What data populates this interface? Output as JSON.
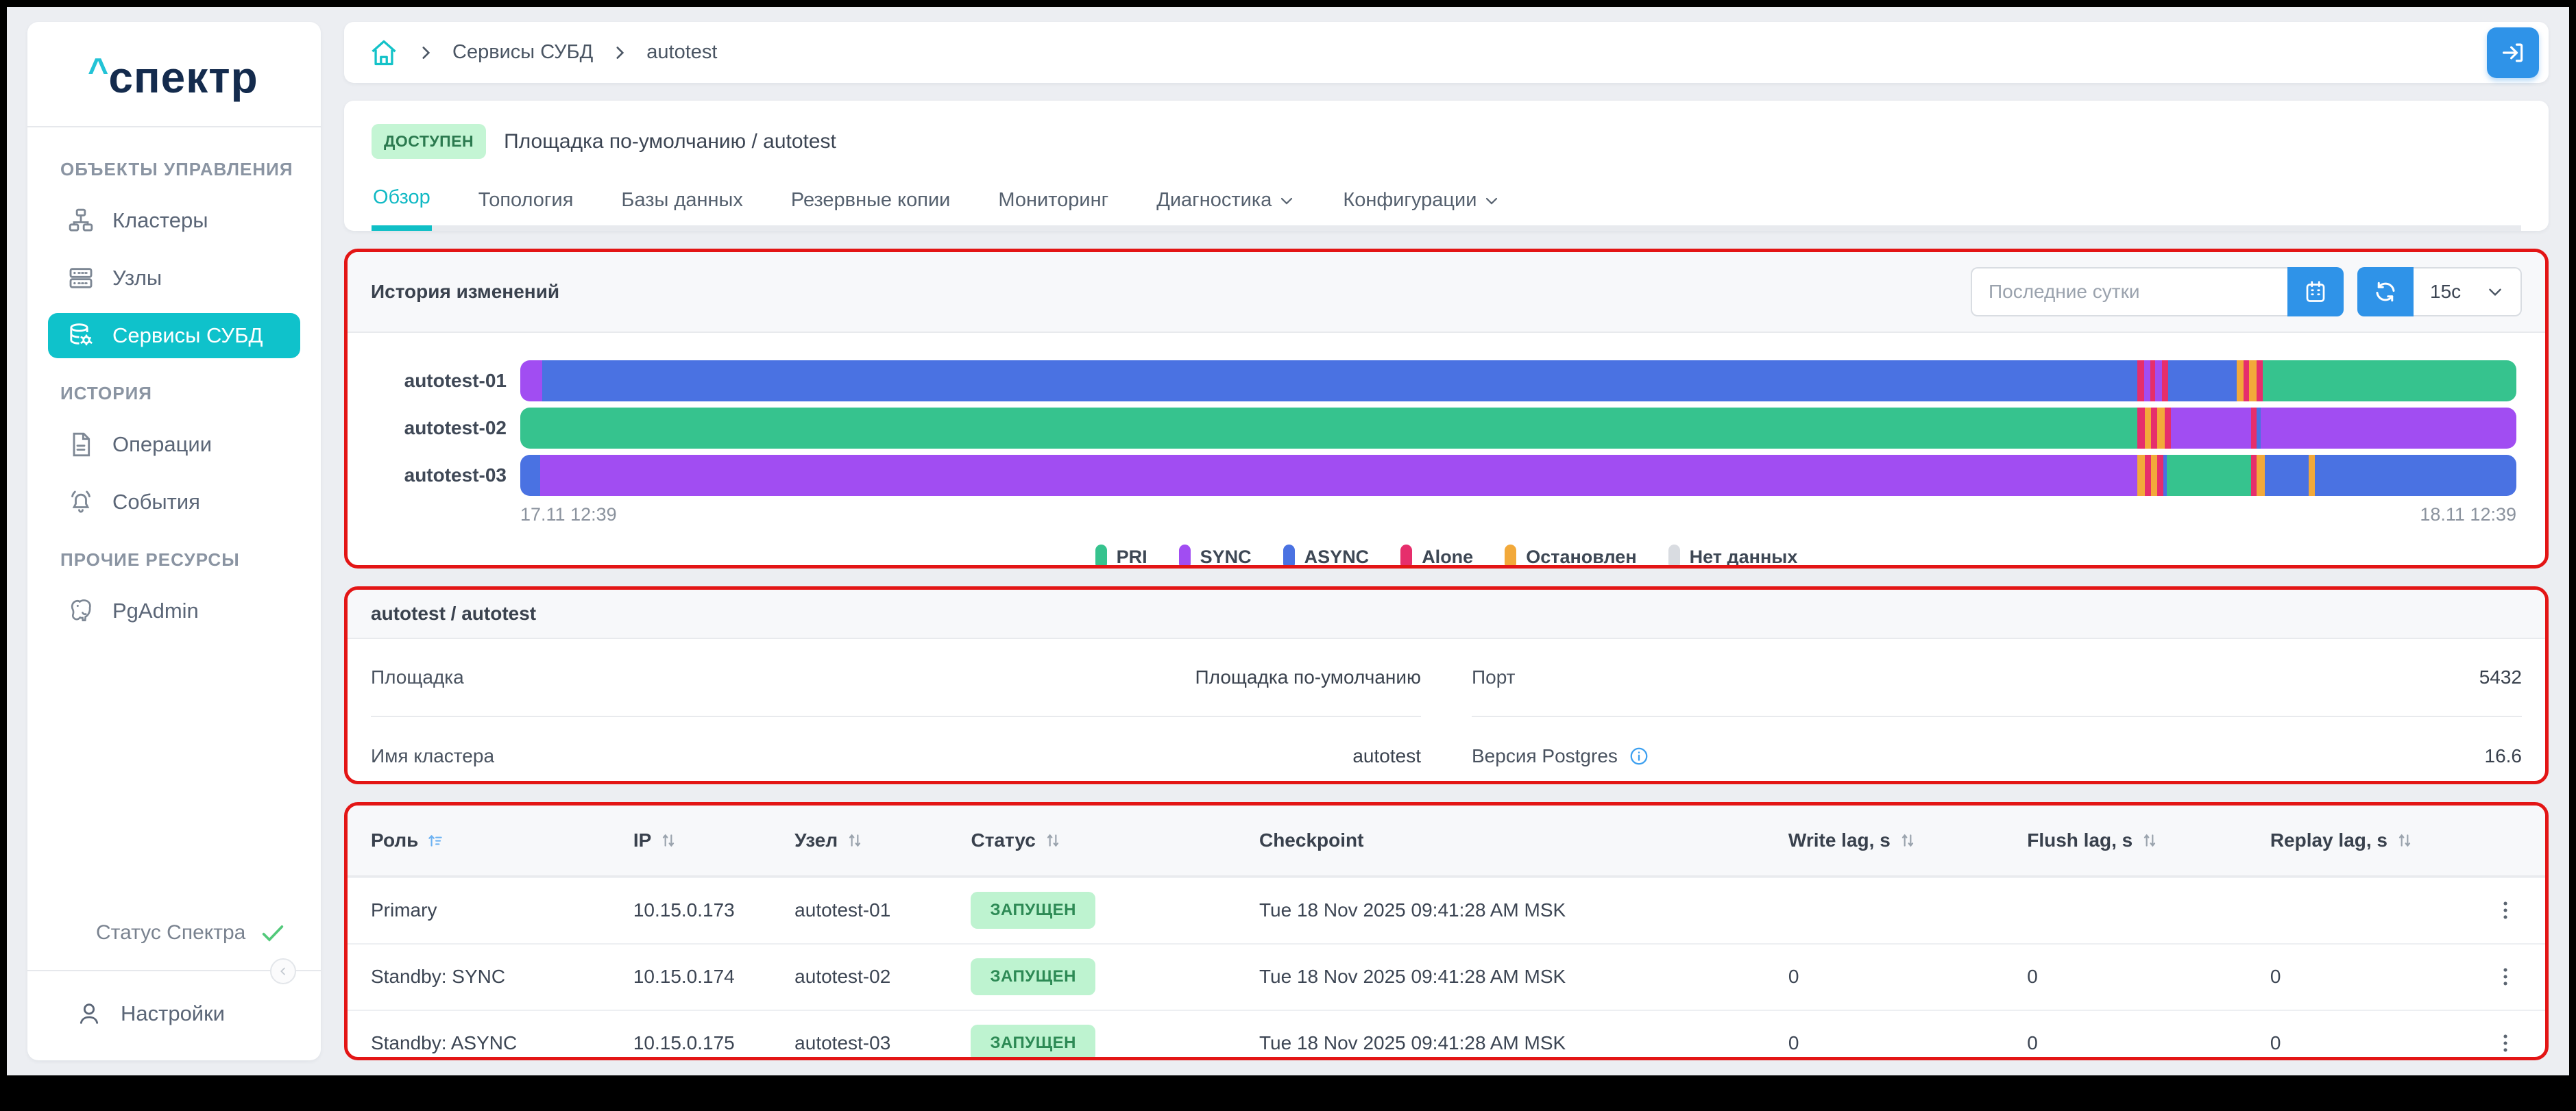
{
  "sidebar": {
    "logo_caret": "^",
    "logo_text": "спектр",
    "section_objects": "ОБЪЕКТЫ УПРАВЛЕНИЯ",
    "item_clusters": "Кластеры",
    "item_nodes": "Узлы",
    "item_services": "Сервисы СУБД",
    "section_history": "ИСТОРИЯ",
    "item_operations": "Операции",
    "item_events": "События",
    "section_other": "ПРОЧИЕ РЕСУРСЫ",
    "item_pgadmin": "PgAdmin",
    "status_label": "Статус Спектра",
    "item_settings": "Настройки"
  },
  "breadcrumb": {
    "item1": "Сервисы СУБД",
    "item2": "autotest"
  },
  "header": {
    "status_badge": "ДОСТУПЕН",
    "title": "Площадка по-умолчанию /  autotest"
  },
  "tabs": {
    "items": [
      {
        "label": "Обзор",
        "active": true
      },
      {
        "label": "Топология",
        "active": false
      },
      {
        "label": "Базы данных",
        "active": false
      },
      {
        "label": "Резервные копии",
        "active": false
      },
      {
        "label": "Мониторинг",
        "active": false
      },
      {
        "label": "Диагностика",
        "active": false,
        "dropdown": true
      },
      {
        "label": "Конфигурации",
        "active": false,
        "dropdown": true
      }
    ]
  },
  "history": {
    "title": "История изменений",
    "range_placeholder": "Последние сутки",
    "refresh_interval": "15с",
    "chart_data": {
      "type": "timeline_status_bar",
      "x_start": "17.11 12:39",
      "x_end": "18.11 12:39",
      "legend": [
        {
          "label": "PRI",
          "color": "#36c38e"
        },
        {
          "label": "SYNC",
          "color": "#a14df2"
        },
        {
          "label": "ASYNC",
          "color": "#4a72e2"
        },
        {
          "label": "Alone",
          "color": "#e62e6c"
        },
        {
          "label": "Остановлен",
          "color": "#f2a93a"
        },
        {
          "label": "Нет данных",
          "color": "#d9dce1"
        }
      ],
      "rows": [
        {
          "label": "autotest-01",
          "segments": [
            [
              "SYNC",
              1.1
            ],
            [
              "ASYNC",
              79.9
            ],
            [
              "Alone",
              0.35
            ],
            [
              "SYNC",
              0.3
            ],
            [
              "Alone",
              0.25
            ],
            [
              "SYNC",
              0.35
            ],
            [
              "Alone",
              0.3
            ],
            [
              "ASYNC",
              3.45
            ],
            [
              "Остановлен",
              0.35
            ],
            [
              "Alone",
              0.25
            ],
            [
              "Остановлен",
              0.4
            ],
            [
              "Alone",
              0.3
            ],
            [
              "PRI",
              12.7
            ]
          ]
        },
        {
          "label": "autotest-02",
          "segments": [
            [
              "PRI",
              81.0
            ],
            [
              "Alone",
              0.4
            ],
            [
              "Остановлен",
              0.3
            ],
            [
              "Alone",
              0.3
            ],
            [
              "Остановлен",
              0.4
            ],
            [
              "Alone",
              0.3
            ],
            [
              "SYNC",
              4.0
            ],
            [
              "Alone",
              0.3
            ],
            [
              "ASYNC",
              0.2
            ],
            [
              "SYNC",
              12.8
            ]
          ]
        },
        {
          "label": "autotest-03",
          "segments": [
            [
              "ASYNC",
              1.0
            ],
            [
              "SYNC",
              80.0
            ],
            [
              "Остановлен",
              0.4
            ],
            [
              "Alone",
              0.3
            ],
            [
              "Остановлен",
              0.3
            ],
            [
              "Alone",
              0.3
            ],
            [
              "ASYNC",
              0.2
            ],
            [
              "PRI",
              4.2
            ],
            [
              "Alone",
              0.3
            ],
            [
              "Остановлен",
              0.4
            ],
            [
              "ASYNC",
              2.2
            ],
            [
              "Остановлен",
              0.3
            ],
            [
              "ASYNC",
              10.1
            ]
          ]
        }
      ]
    }
  },
  "info_card": {
    "title": "autotest / autotest",
    "site_label": "Площадка",
    "site_value": "Площадка по-умолчанию",
    "port_label": "Порт",
    "port_value": "5432",
    "cluster_label": "Имя кластера",
    "cluster_value": "autotest",
    "version_label": "Версия Postgres",
    "version_value": "16.6"
  },
  "table": {
    "headers": {
      "role": "Роль",
      "ip": "IP",
      "node": "Узел",
      "status": "Статус",
      "checkpoint": "Checkpoint",
      "write": "Write lag, s",
      "flush": "Flush lag, s",
      "replay": "Replay lag, s"
    },
    "rows": [
      {
        "role": "Primary",
        "ip": "10.15.0.173",
        "node": "autotest-01",
        "status": "ЗАПУЩЕН",
        "checkpoint": "Tue 18 Nov 2025 09:41:28 AM MSK",
        "write": "",
        "flush": "",
        "replay": ""
      },
      {
        "role": "Standby: SYNC",
        "ip": "10.15.0.174",
        "node": "autotest-02",
        "status": "ЗАПУЩЕН",
        "checkpoint": "Tue 18 Nov 2025 09:41:28 AM MSK",
        "write": "0",
        "flush": "0",
        "replay": "0"
      },
      {
        "role": "Standby: ASYNC",
        "ip": "10.15.0.175",
        "node": "autotest-03",
        "status": "ЗАПУЩЕН",
        "checkpoint": "Tue 18 Nov 2025 09:41:28 AM MSK",
        "write": "0",
        "flush": "0",
        "replay": "0"
      }
    ]
  },
  "colors": {
    "accent_teal": "#0fc2cb",
    "primary_blue": "#2f93e8",
    "annotation_red": "#e31515",
    "badge_green_bg": "#c4f5d4",
    "badge_green_text": "#2b7a4f",
    "page_bg": "#eceef2",
    "logo_navy": "#142b4d"
  }
}
